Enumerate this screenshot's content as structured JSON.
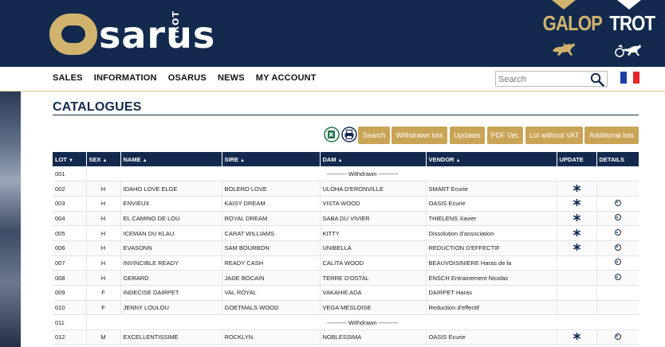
{
  "header": {
    "logo_text": "Osarus",
    "logo_sub": "TROT",
    "galop_label": "GALOP",
    "trot_label": "TROT"
  },
  "nav": {
    "items": [
      "SALES",
      "INFORMATION",
      "OSARUS",
      "NEWS",
      "MY ACCOUNT"
    ]
  },
  "search": {
    "placeholder": "Search"
  },
  "flag": {
    "colors": [
      "#1f3fa8",
      "#ffffff",
      "#e5262b"
    ]
  },
  "page": {
    "title": "CATALOGUES"
  },
  "toolbar": {
    "excel_icon": "excel-icon",
    "print_icon": "print-icon",
    "buttons": [
      "Search",
      "Withdrawn lots",
      "Updates",
      "PDF Vet.",
      "Lot without VAT",
      "Additional lots"
    ]
  },
  "table": {
    "headers": {
      "lot": "LOT",
      "sex": "SEX",
      "name": "NAME",
      "sire": "SIRE",
      "dam": "DAM",
      "vendor": "VENDOR",
      "update": "UPDATE",
      "details": "DETAILS"
    },
    "withdrawn_text": "---------- Withdrawn ----------",
    "rows": [
      {
        "lot": "001",
        "withdrawn": true
      },
      {
        "lot": "002",
        "sex": "H",
        "name": "IDAHO LOVE ELGE",
        "sire": "BOLERO LOVE",
        "dam": "ULOHA D'ERONVILLE",
        "vendor": "SMART Ecurie",
        "update": true,
        "details": false
      },
      {
        "lot": "003",
        "sex": "H",
        "name": "ENVIEUX",
        "sire": "KAISY DREAM",
        "dam": "VISTA WOOD",
        "vendor": "OASIS Ecurie",
        "update": true,
        "details": true
      },
      {
        "lot": "004",
        "sex": "H",
        "name": "EL CAMINO DE LOU",
        "sire": "ROYAL DREAM",
        "dam": "SABA DU VIVIER",
        "vendor": "THIELENS Xavier",
        "update": true,
        "details": true
      },
      {
        "lot": "005",
        "sex": "H",
        "name": "ICEMAN DU KLAU",
        "sire": "CARAT WILLIAMS",
        "dam": "KITTY",
        "vendor": "Dissolution d'association",
        "update": true,
        "details": true
      },
      {
        "lot": "006",
        "sex": "H",
        "name": "EVASONN",
        "sire": "SAM BOURBON",
        "dam": "UNIBELLA",
        "vendor": "REDUCTION D'EFFECTIF",
        "update": true,
        "details": true
      },
      {
        "lot": "007",
        "sex": "H",
        "name": "INVINCIBLE READY",
        "sire": "READY CASH",
        "dam": "CALITA WOOD",
        "vendor": "BEAUVOISINIERE Haras de la",
        "update": false,
        "details": true
      },
      {
        "lot": "008",
        "sex": "H",
        "name": "GERARD",
        "sire": "JADE BOCAIN",
        "dam": "TERRE D'OSTAL",
        "vendor": "ENSCH Entrainement Nicolas",
        "update": false,
        "details": true
      },
      {
        "lot": "009",
        "sex": "F",
        "name": "INDECISE DAIRPET",
        "sire": "VAL ROYAL",
        "dam": "VAKAHIE ADA",
        "vendor": "DAIRPET Haras",
        "update": false,
        "details": false
      },
      {
        "lot": "010",
        "sex": "F",
        "name": "JENNY LOULOU",
        "sire": "GOETMALS WOOD",
        "dam": "VEGA MESLOISE",
        "vendor": "Reduction d'effectif",
        "update": false,
        "details": false
      },
      {
        "lot": "011",
        "withdrawn": true
      },
      {
        "lot": "012",
        "sex": "M",
        "name": "EXCELLENTISSIME",
        "sire": "ROCKLYN",
        "dam": "NOBLESSIMA",
        "vendor": "OASIS Ecurie",
        "update": true,
        "details": true
      }
    ]
  }
}
